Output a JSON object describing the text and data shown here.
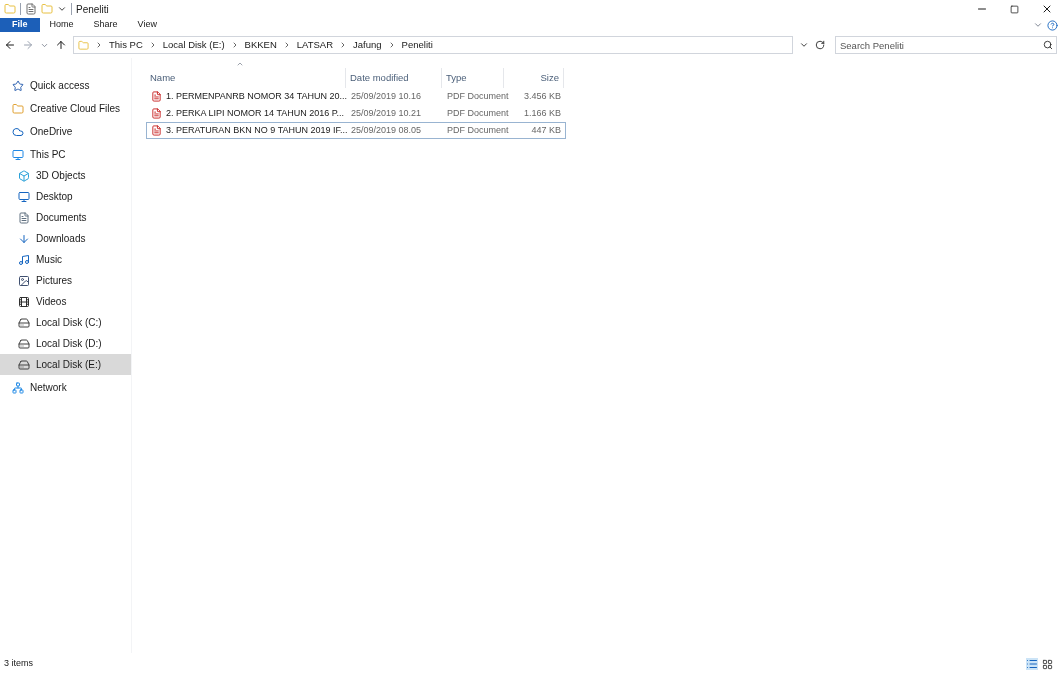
{
  "window": {
    "title": "Peneliti"
  },
  "ribbon_tabs": [
    {
      "label": "File",
      "kind": "file"
    },
    {
      "label": "Home",
      "kind": "tab"
    },
    {
      "label": "Share",
      "kind": "tab"
    },
    {
      "label": "View",
      "kind": "tab"
    }
  ],
  "breadcrumb": [
    "This PC",
    "Local Disk (E:)",
    "BKKEN",
    "LATSAR",
    "Jafung",
    "Peneliti"
  ],
  "search": {
    "placeholder": "Search Peneliti"
  },
  "sidebar": {
    "items": [
      {
        "label": "Quick access",
        "kind": "star",
        "selected": false
      },
      {
        "label": "Creative Cloud Files",
        "kind": "cloudfiles",
        "selected": false
      },
      {
        "label": "OneDrive",
        "kind": "cloud",
        "selected": false
      },
      {
        "label": "This PC",
        "kind": "pc",
        "selected": false,
        "children": [
          {
            "label": "3D Objects",
            "kind": "cube",
            "selected": false
          },
          {
            "label": "Desktop",
            "kind": "desktop",
            "selected": false
          },
          {
            "label": "Documents",
            "kind": "doc",
            "selected": false
          },
          {
            "label": "Downloads",
            "kind": "download",
            "selected": false
          },
          {
            "label": "Music",
            "kind": "music",
            "selected": false
          },
          {
            "label": "Pictures",
            "kind": "pictures",
            "selected": false
          },
          {
            "label": "Videos",
            "kind": "video",
            "selected": false
          },
          {
            "label": "Local Disk (C:)",
            "kind": "disk",
            "selected": false
          },
          {
            "label": "Local Disk (D:)",
            "kind": "disk",
            "selected": false
          },
          {
            "label": "Local Disk (E:)",
            "kind": "disk",
            "selected": true
          }
        ]
      },
      {
        "label": "Network",
        "kind": "network",
        "selected": false
      }
    ]
  },
  "table": {
    "columns": [
      "Name",
      "Date modified",
      "Type",
      "Size"
    ],
    "rows": [
      {
        "name": "1. PERMENPANRB NOMOR 34 TAHUN 20...",
        "date": "25/09/2019 10.16",
        "type": "PDF Document",
        "size": "3.456 KB",
        "focused": false
      },
      {
        "name": "2. PERKA LIPI NOMOR 14 TAHUN 2016 P...",
        "date": "25/09/2019 10.21",
        "type": "PDF Document",
        "size": "1.166 KB",
        "focused": false
      },
      {
        "name": "3. PERATURAN BKN NO 9 TAHUN 2019 IF...",
        "date": "25/09/2019 08.05",
        "type": "PDF Document",
        "size": "447 KB",
        "focused": true
      }
    ]
  },
  "status_bar": {
    "text": "3 items"
  }
}
